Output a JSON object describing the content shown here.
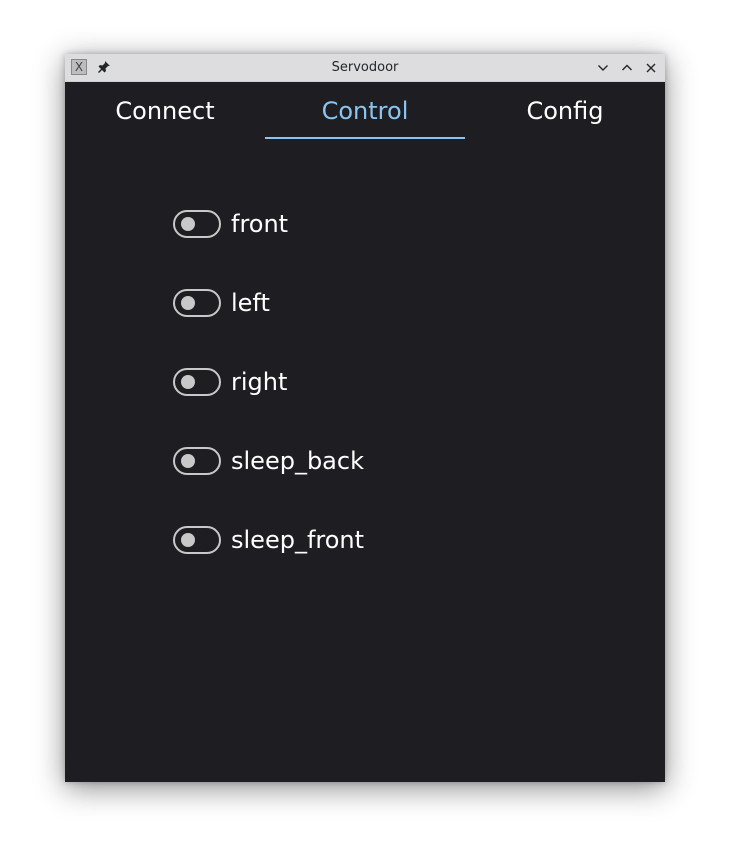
{
  "window": {
    "title": "Servodoor",
    "app_icon_glyph": "X",
    "icons": {
      "app": "app-icon",
      "pin": "pin-icon",
      "minimize": "chevron-down-icon",
      "maximize": "chevron-up-icon",
      "close": "close-icon"
    }
  },
  "tabs": [
    {
      "label": "Connect",
      "active": false
    },
    {
      "label": "Control",
      "active": true
    },
    {
      "label": "Config",
      "active": false
    }
  ],
  "switches": [
    {
      "label": "front",
      "checked": false
    },
    {
      "label": "left",
      "checked": false
    },
    {
      "label": "right",
      "checked": false
    },
    {
      "label": "sleep_back",
      "checked": false
    },
    {
      "label": "sleep_front",
      "checked": false
    }
  ],
  "colors": {
    "background": "#1e1e22",
    "accent": "#8cc4ef",
    "text": "#ffffff",
    "switch_outline": "#c8c8c8",
    "titlebar": "#dddddf"
  }
}
